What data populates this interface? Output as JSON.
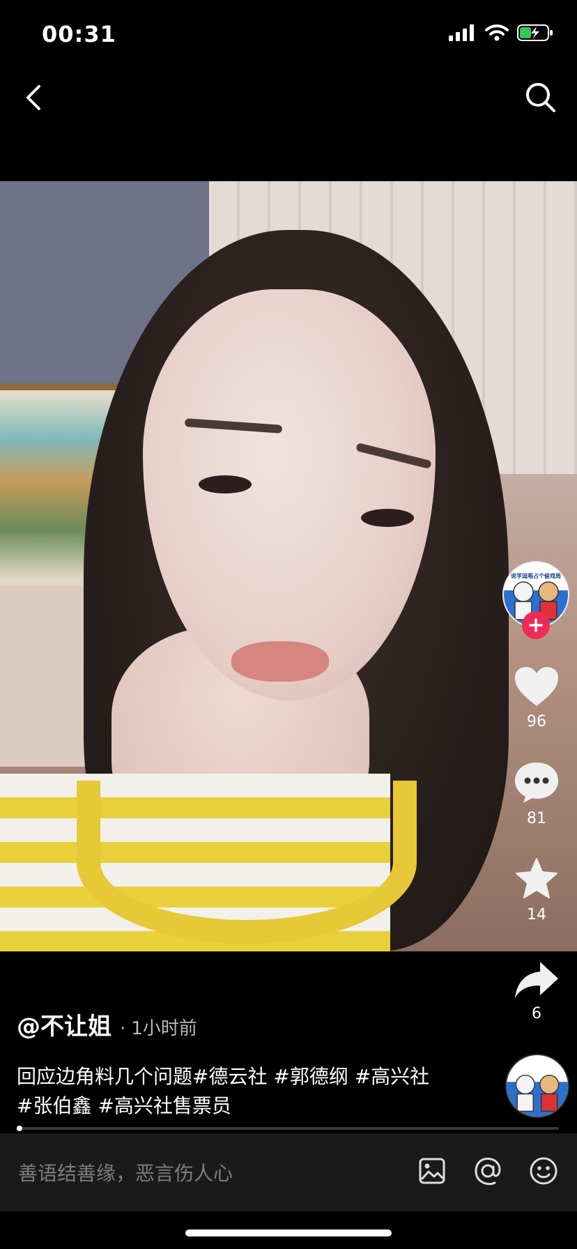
{
  "status_bar": {
    "time": "00:31"
  },
  "icons": {
    "back": "chevron-left-icon",
    "search": "search-icon",
    "like": "heart-icon",
    "comment": "comment-bubble-icon",
    "favorite": "star-icon",
    "share": "share-arrow-icon",
    "image": "image-icon",
    "mention": "at-icon",
    "emoji": "emoji-icon"
  },
  "actions": {
    "likes": "96",
    "comments": "81",
    "favorites": "14",
    "shares": "6"
  },
  "post": {
    "username": "@不让姐",
    "separator": "·",
    "time_ago": "1小时前",
    "caption_line1": "回应边角料几个问题#德云社 #郭德纲 #高兴社",
    "caption_line2": "#张伯鑫 #高兴社售票员"
  },
  "avatar_text": "说学逗唱占个偷戏局",
  "progress": {
    "fraction": 0.003
  },
  "comment_bar": {
    "placeholder": "善语结善缘，恶言伤人心"
  },
  "colors": {
    "accent": "#ef2b55",
    "battery": "#34c759"
  }
}
